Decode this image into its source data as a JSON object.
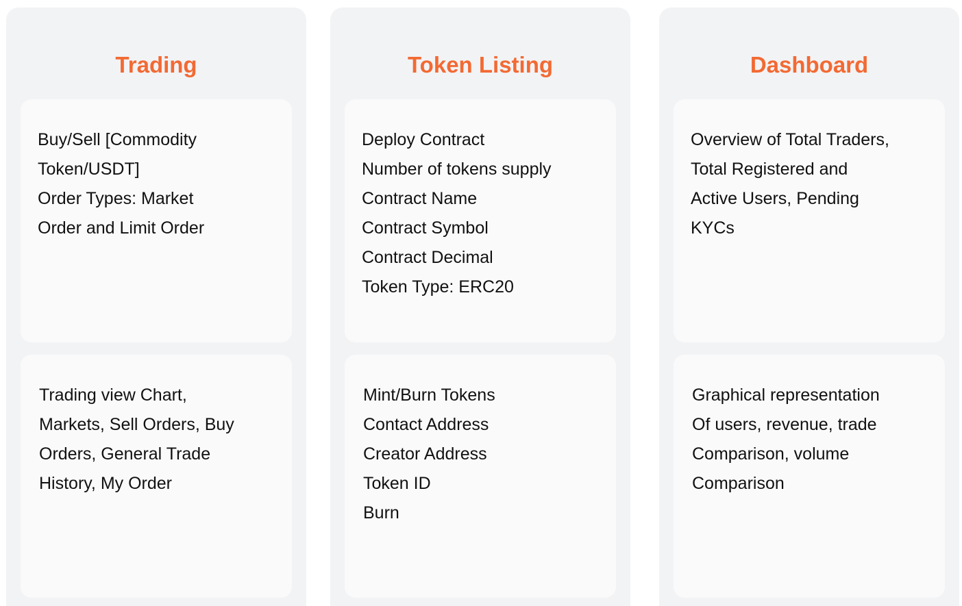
{
  "columns": [
    {
      "title": "Trading",
      "top_card_lines": [
        "Buy/Sell [Commodity",
        "Token/USDT]",
        "Order Types: Market",
        "Order and Limit Order"
      ],
      "bottom_card_lines": [
        "Trading view Chart,",
        "Markets, Sell Orders, Buy",
        "Orders, General Trade",
        "History, My Order"
      ]
    },
    {
      "title": "Token Listing",
      "top_card_lines": [
        "Deploy Contract",
        "Number of tokens supply",
        "Contract Name",
        "Contract Symbol",
        "Contract Decimal",
        "Token Type: ERC20"
      ],
      "bottom_card_lines": [
        "Mint/Burn Tokens",
        "Contact Address",
        "Creator Address",
        "Token ID",
        "Burn"
      ]
    },
    {
      "title": "Dashboard",
      "top_card_lines": [
        "Overview of Total Traders,",
        "Total Registered and",
        "Active Users, Pending",
        "KYCs"
      ],
      "bottom_card_lines": [
        "Graphical representation",
        "Of users, revenue, trade",
        "Comparison, volume",
        "Comparison"
      ]
    }
  ],
  "colors": {
    "accent": "#f26a33",
    "column_bg": "#f2f3f5",
    "card_bg": "#fafafa",
    "text": "#111111"
  }
}
